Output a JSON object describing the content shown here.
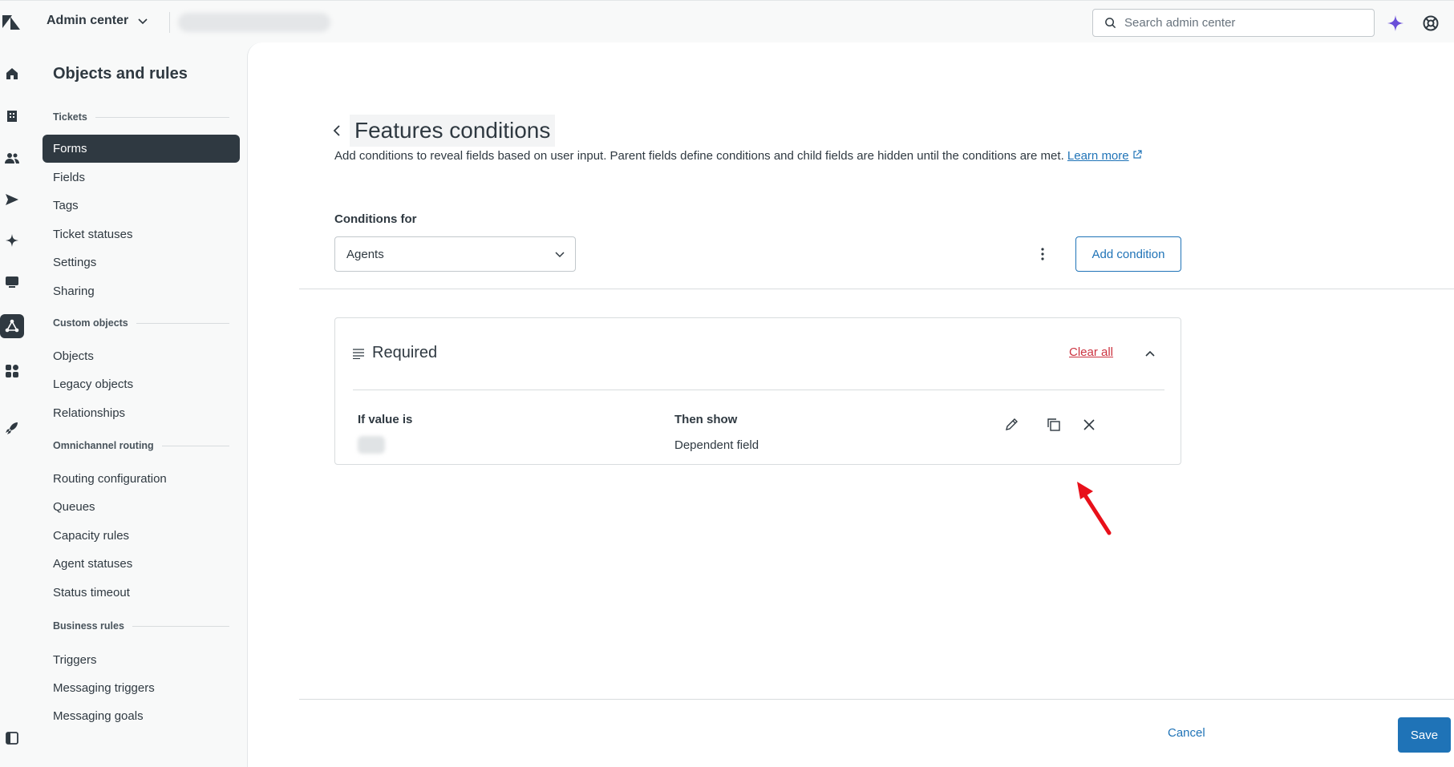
{
  "header": {
    "product_label": "Admin center",
    "search_placeholder": "Search admin center",
    "icons": [
      "zendesk-logo-icon",
      "chevron-down-icon",
      "search-icon",
      "ai-sparkle-icon",
      "help-icon"
    ]
  },
  "rail": {
    "icons": [
      "home-icon",
      "building-icon",
      "people-icon",
      "send-icon",
      "sparkle-icon",
      "monitor-icon",
      "objects-rules-icon",
      "apps-icon",
      "rocket-icon",
      "panel-toggle-icon"
    ],
    "active": "objects-rules-icon"
  },
  "nav": {
    "title": "Objects and rules",
    "sections": [
      {
        "label": "Tickets",
        "items": [
          "Forms",
          "Fields",
          "Tags",
          "Ticket statuses",
          "Settings",
          "Sharing"
        ]
      },
      {
        "label": "Custom objects",
        "items": [
          "Objects",
          "Legacy objects",
          "Relationships"
        ]
      },
      {
        "label": "Omnichannel routing",
        "items": [
          "Routing configuration",
          "Queues",
          "Capacity rules",
          "Agent statuses",
          "Status timeout"
        ]
      },
      {
        "label": "Business rules",
        "items": [
          "Triggers",
          "Messaging triggers",
          "Messaging goals"
        ]
      }
    ],
    "active_item": "Forms"
  },
  "page": {
    "title": "Features conditions",
    "description": "Add conditions to reveal fields based on user input. Parent fields define conditions and child fields are hidden until the conditions are met.",
    "learn_more": "Learn more",
    "conditions_for_label": "Conditions for",
    "conditions_for_value": "Agents",
    "add_condition_label": "Add condition"
  },
  "condition_card": {
    "title": "Required",
    "clear_all": "Clear all",
    "if_value_header": "If value is",
    "then_show_header": "Then show",
    "then_show_value": "Dependent field"
  },
  "footer": {
    "cancel_label": "Cancel",
    "save_label": "Save"
  },
  "colors": {
    "primary": "#1f73b7",
    "danger": "#cc3340",
    "dark": "#2f3941",
    "annotation_arrow": "#e8101a",
    "ai_accent": "#6a4fd8"
  }
}
